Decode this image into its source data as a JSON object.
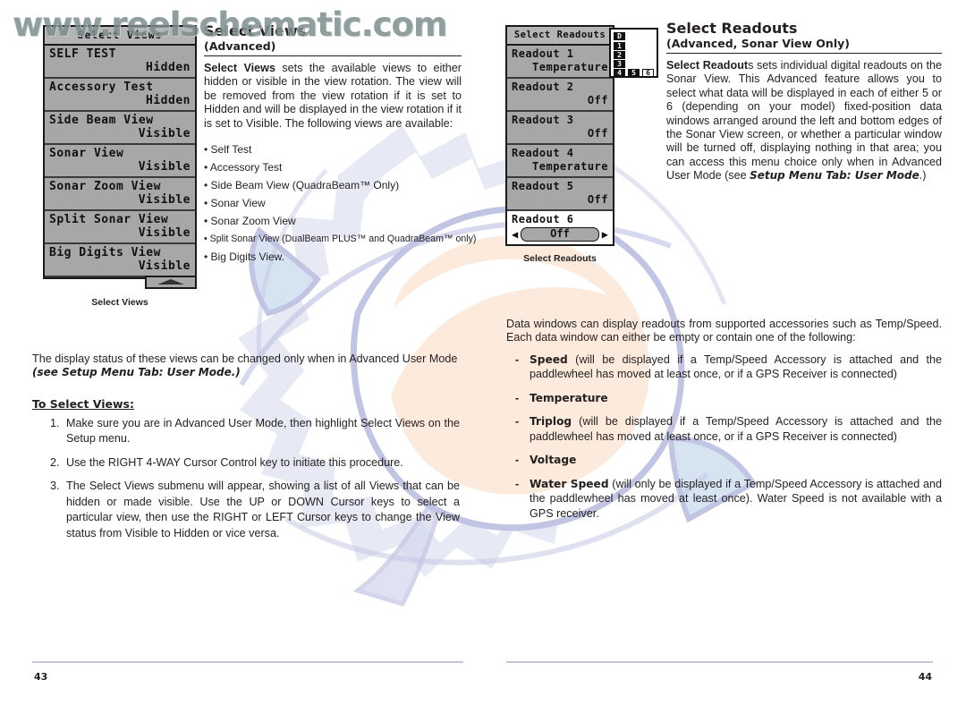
{
  "watermark": "www.reelschematic.com",
  "left_page": {
    "page_number": "43",
    "lcd": {
      "title": "Select Views",
      "caption": "Select Views",
      "scroll_icon": "scroll-up-arrow-icon",
      "rows": [
        {
          "label": "SELF TEST",
          "value": "Hidden"
        },
        {
          "label": "Accessory Test",
          "value": "Hidden"
        },
        {
          "label": "Side Beam View",
          "value": "Visible"
        },
        {
          "label": "Sonar View",
          "value": "Visible"
        },
        {
          "label": "Sonar Zoom View",
          "value": "Visible"
        },
        {
          "label": "Split Sonar View",
          "value": "Visible"
        },
        {
          "label": "Big Digits View",
          "value": "Visible"
        }
      ]
    },
    "heading": "Select Views",
    "subheading": "(Advanced)",
    "intro_lead": "Select Views",
    "intro_rest": " sets the available views to either hidden or visible in the view rotation.  The view will be removed from the view rotation if it is set to Hidden and will be displayed in the view rotation if it is set to Visible. The following views are available:",
    "views_bullets": [
      "• Self Test",
      "• Accessory Test",
      "• Side Beam View (QuadraBeam™ Only)",
      "• Sonar View",
      "• Sonar Zoom View",
      "• Split Sonar View (DualBeam PLUS™ and QuadraBeam™ only)",
      "• Big Digits View."
    ],
    "note_plain": "The display status of these views can be changed only when in Advanced User Mode ",
    "note_italic": "(see Setup Menu Tab: User Mode.)",
    "procedure_heading": "To Select Views:",
    "steps": [
      "Make sure you are in Advanced User Mode, then highlight Select Views on the Setup menu.",
      "Use the RIGHT 4-WAY Cursor Control key to initiate this procedure.",
      "The Select Views submenu will appear, showing a list of all Views that can be hidden or made visible. Use the UP or DOWN Cursor keys to select a particular view, then use the RIGHT or LEFT Cursor keys to change the View status from Visible to Hidden or vice versa."
    ]
  },
  "right_page": {
    "page_number": "44",
    "lcd": {
      "title": "Select Readouts",
      "caption": "Select Readouts",
      "rows": [
        {
          "label": "Readout 1",
          "value": "Temperature",
          "highlight": false
        },
        {
          "label": "Readout 2",
          "value": "Off",
          "highlight": false
        },
        {
          "label": "Readout 3",
          "value": "Off",
          "highlight": false
        },
        {
          "label": "Readout 4",
          "value": "Temperature",
          "highlight": false
        },
        {
          "label": "Readout 5",
          "value": "Off",
          "highlight": false
        },
        {
          "label": "Readout 6",
          "value": "Off",
          "highlight": true
        }
      ]
    },
    "diagram": {
      "name": "readout-position-diagram",
      "cells": [
        "D",
        "1",
        "2",
        "3",
        "4",
        "5",
        "6"
      ]
    },
    "heading": "Select Readouts",
    "subheading": "(Advanced, Sonar View Only)",
    "intro_lead": "Select Readout",
    "intro_rest": "s sets individual digital readouts on the Sonar View. This Advanced feature allows you to select what data will be displayed in each of either 5 or 6 (depending on your model) fixed-position data windows arranged around the left and bottom edges of the Sonar View screen, or whether a particular window will be turned off, displaying nothing in that area; you can access this menu choice only when in Advanced User Mode (see ",
    "intro_italic": "Setup Menu Tab: User Mode",
    "intro_tail": ".)",
    "paragraph2": "Data windows can display readouts from supported accessories such as Temp/Speed. Each data window can either be empty or contain one of the following:",
    "options": [
      {
        "term": "Speed",
        "desc": " (will be displayed if a Temp/Speed Accessory is attached and the paddlewheel has moved at least once, or if a GPS Receiver is connected)"
      },
      {
        "term": "Temperature",
        "desc": ""
      },
      {
        "term": "Triplog",
        "desc": " (will be displayed if a Temp/Speed Accessory is attached and the paddlewheel has moved at least once, or if a GPS Receiver is connected)"
      },
      {
        "term": "Voltage",
        "desc": ""
      },
      {
        "term": "Water Speed",
        "desc": " (will only be displayed if a Temp/Speed Accessory is attached and the paddlewheel has moved at least once).  Water Speed is not available with a GPS receiver."
      }
    ]
  },
  "colors": {
    "text": "#231f20",
    "watermark": "#7d8f8e",
    "lcd_background": "#a7a7a7",
    "lcd_border": "#1a1a1a",
    "rule": "#c6c5de",
    "art_lavender": "#bfc1e0",
    "art_blue": "#cfe0f0",
    "art_peach": "#fbe0c8"
  }
}
